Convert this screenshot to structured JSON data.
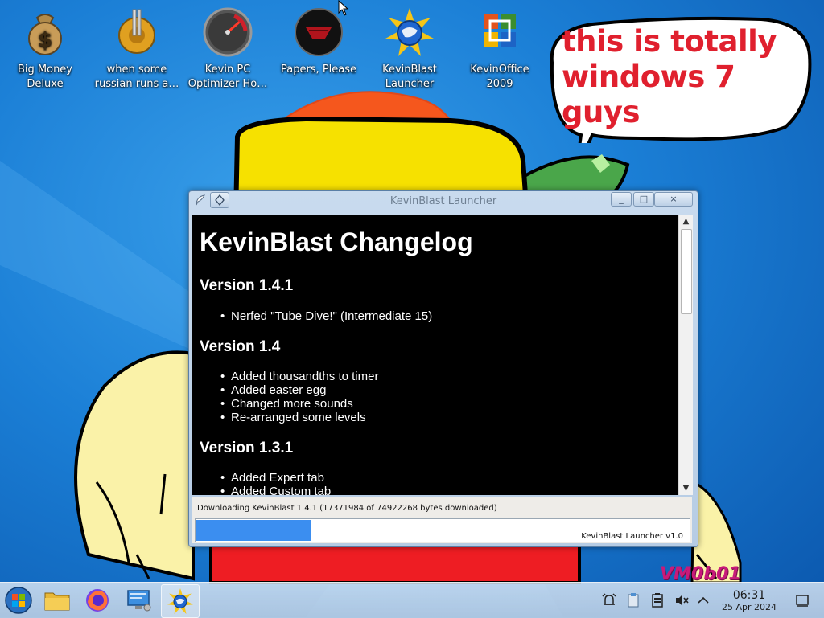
{
  "desktop": {
    "icons": [
      {
        "label": "Big Money\nDeluxe",
        "icon": "money-bag-icon"
      },
      {
        "label": "when some\nrussian runs a…",
        "icon": "gear-pipes-icon"
      },
      {
        "label": "Kevin PC\nOptimizer Ho…",
        "icon": "speedometer-icon"
      },
      {
        "label": "Papers, Please",
        "icon": "papers-please-emblem-icon"
      },
      {
        "label": "KevinBlast\nLauncher",
        "icon": "kevinblast-globe-icon"
      },
      {
        "label": "KevinOffice\n2009",
        "icon": "office-logo-icon"
      }
    ],
    "speech_bubble": "this is totally windows 7 guys",
    "watermark": "VM0b01"
  },
  "window": {
    "title": "KevinBlast Launcher",
    "buttons": {
      "minimize": "_",
      "maximize": "□",
      "close": "×"
    },
    "changelog": {
      "heading": "KevinBlast Changelog",
      "versions": [
        {
          "version": "Version 1.4.1",
          "changes": [
            "Nerfed \"Tube Dive!\" (Intermediate 15)"
          ]
        },
        {
          "version": "Version 1.4",
          "changes": [
            "Added thousandths to timer",
            "Added easter egg",
            "Changed more sounds",
            "Re-arranged some levels"
          ]
        },
        {
          "version": "Version 1.3.1",
          "changes": [
            "Added Expert tab",
            "Added Custom tab"
          ]
        }
      ]
    },
    "status": "Downloading KevinBlast 1.4.1 (17371984 of 74922268 bytes downloaded)",
    "progress_fraction": 0.232,
    "footer_version": "KevinBlast Launcher v1.0"
  },
  "taskbar": {
    "items": [
      {
        "name": "start-button",
        "icon": "windows-orb-icon"
      },
      {
        "name": "file-manager",
        "icon": "folder-icon"
      },
      {
        "name": "firefox",
        "icon": "firefox-icon"
      },
      {
        "name": "control-panel",
        "icon": "computer-monitor-icon"
      },
      {
        "name": "kevinblast-launcher",
        "icon": "kevinblast-globe-icon",
        "active": true
      }
    ],
    "tray": [
      "alarm-icon",
      "clipboard-icon",
      "battery-icon",
      "speaker-muted-icon",
      "chevron-up-icon"
    ],
    "clock": {
      "time": "06:31",
      "date": "25 Apr 2024"
    }
  },
  "colors": {
    "bubble_text": "#e0202e",
    "progress": "#3b8ef0",
    "desktop": "#1b7fd6"
  }
}
